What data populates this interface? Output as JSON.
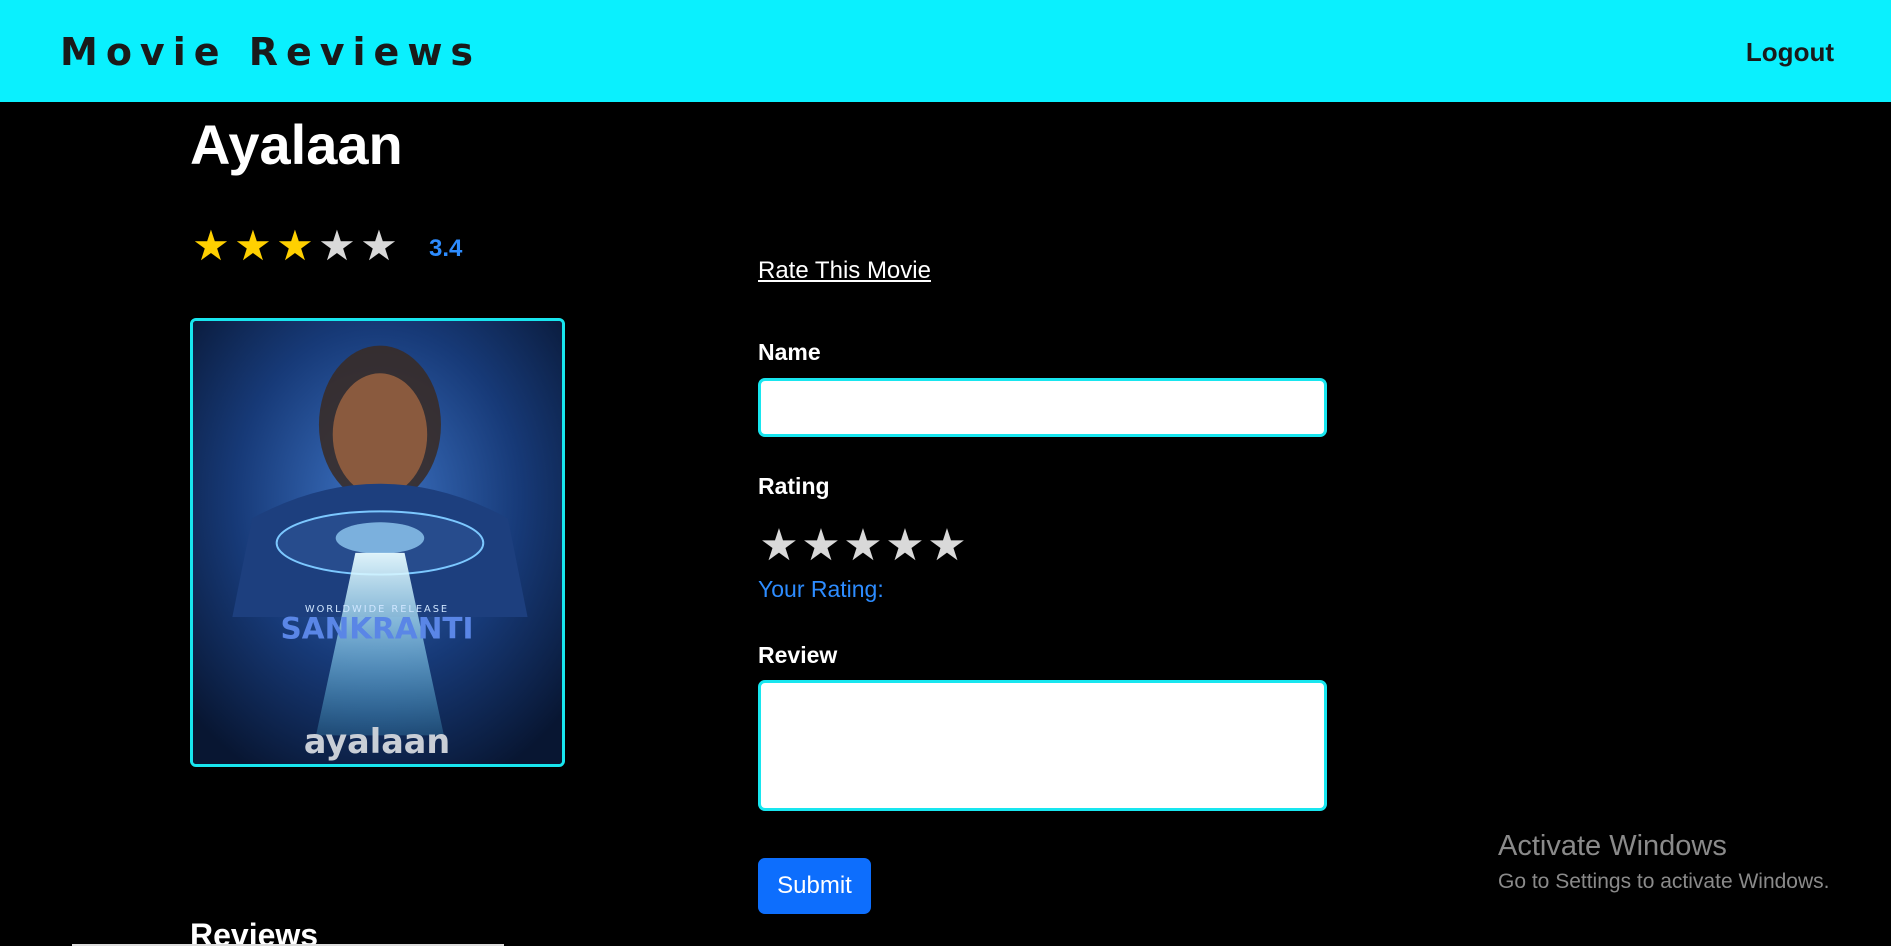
{
  "navbar": {
    "brand": "Movie Reviews",
    "logout_label": "Logout"
  },
  "movie": {
    "title": "Ayalaan",
    "average_rating": "3.4",
    "average_stars": {
      "filled": 3,
      "total": 5
    },
    "poster_text": {
      "release_line": "WORLDWIDE RELEASE",
      "festival": "SANKRANTI",
      "logo": "ayalaan"
    }
  },
  "rate_form": {
    "heading": "Rate This Movie",
    "name_label": "Name",
    "name_value": "",
    "rating_label": "Rating",
    "rating_stars": {
      "selected": 0,
      "total": 5
    },
    "your_rating_label": "Your Rating:",
    "review_label": "Review",
    "review_value": "",
    "submit_label": "Submit"
  },
  "reviews": {
    "heading": "Reviews"
  },
  "os_watermark": {
    "title": "Activate Windows",
    "subtitle": "Go to Settings to activate Windows."
  },
  "colors": {
    "navbar_bg": "#0af0fe",
    "star_filled": "#ffd000",
    "star_empty": "#d9d9d9",
    "accent_blue": "#2d8cff",
    "submit_bg": "#0d6efd",
    "input_border": "#18e6ef"
  },
  "icons": {
    "star_filled": "star-filled-icon",
    "star_empty": "star-empty-icon"
  }
}
